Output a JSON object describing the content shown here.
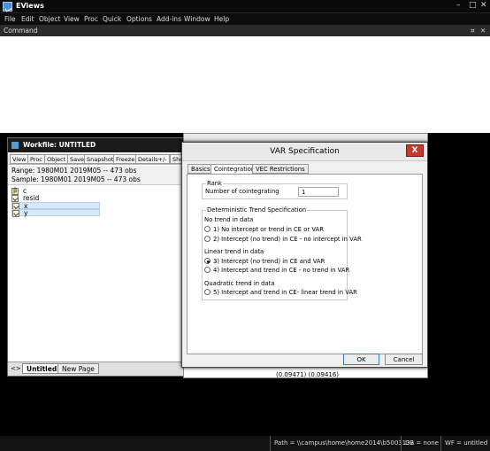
{
  "app": {
    "title": "EViews"
  },
  "menu": [
    "File",
    "Edit",
    "Object",
    "View",
    "Proc",
    "Quick",
    "Options",
    "Add-ins",
    "Window",
    "Help"
  ],
  "command": {
    "label": "Command"
  },
  "status": {
    "path": "Path = \\\\campus\\home\\home2014\\b5003132",
    "db": "DB = none",
    "wf": "WF = untitled"
  },
  "workfile": {
    "title": "Workfile: UNTITLED",
    "toolbar": [
      "View",
      "Proc",
      "Object",
      "Save",
      "Snapshot",
      "Freeze",
      "Details+/-",
      "Sho"
    ],
    "range": "Range:  1980M01 2019M05  --  473 obs",
    "sample": "Sample: 1980M01 2019M05  --  473 obs",
    "objects": [
      {
        "name": "c",
        "icon": "coefficient-icon"
      },
      {
        "name": "resid",
        "icon": "series-icon"
      },
      {
        "name": "x",
        "icon": "series-icon"
      },
      {
        "name": "y",
        "icon": "series-icon"
      }
    ],
    "tabs": {
      "arrows": "<>",
      "active": "Untitled",
      "new": "New Page"
    }
  },
  "eqwin": {
    "footer": "(0.09471)       (0.09416)"
  },
  "dialog": {
    "title": "VAR Specification",
    "close": "X",
    "tabs": [
      "Basics",
      "Cointegration",
      "VEC Restrictions"
    ],
    "rank": {
      "group": "Rank",
      "label": "Number of cointegrating",
      "value": "1"
    },
    "trend": {
      "group": "Deterministic Trend Specification",
      "no_trend": "No trend in data",
      "linear": "Linear trend in data",
      "quadratic": "Quadratic trend in data",
      "opt1": "1)   No intercept or trend in CE or VAR",
      "opt2": "2)   Intercept (no trend) in CE - no intercept in VAR",
      "opt3": "3)   Intercept (no trend) in CE and VAR",
      "opt4": "4)   Intercept and trend in CE - no trend in VAR",
      "opt5": "5)   Intercept and trend in CE- linear trend in VAR",
      "selected": 3
    },
    "ok": "OK",
    "cancel": "Cancel"
  }
}
